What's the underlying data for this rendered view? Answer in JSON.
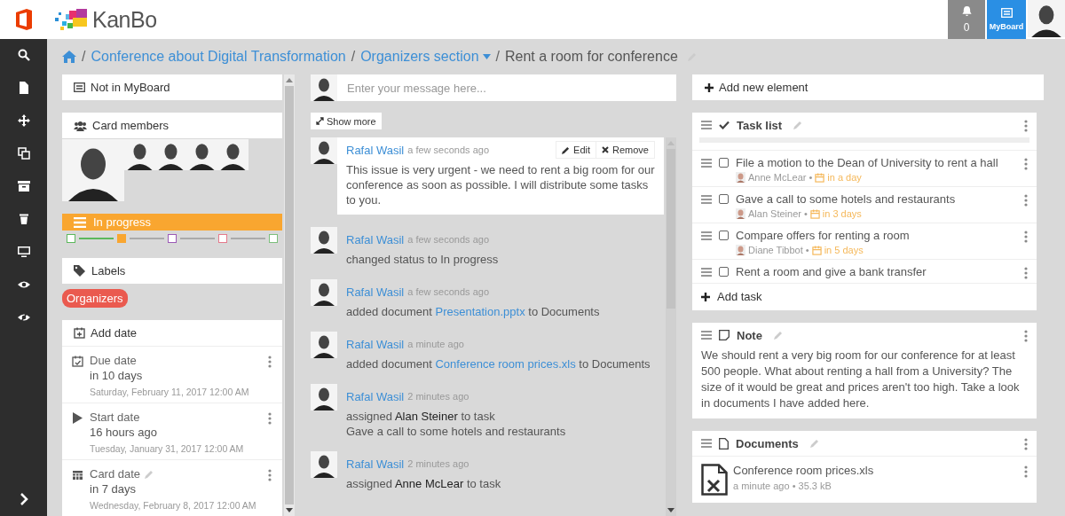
{
  "header": {
    "brand": "KanBo",
    "notifications": "0",
    "myboard": "MyBoard"
  },
  "breadcrumb": [
    {
      "separator": "/",
      "text": "Conference about Digital Transformation",
      "kind": "link"
    },
    {
      "separator": "/",
      "text": "Organizers section",
      "kind": "dropdown"
    },
    {
      "separator": "/",
      "text": "Rent a room for conference",
      "kind": "current"
    }
  ],
  "details": {
    "myboard": "Not in MyBoard",
    "members_title": "Card members",
    "status": {
      "label": "In progress",
      "steps": [
        {
          "color": "#5cb85c",
          "selected": false
        },
        {
          "color": "#f9a630",
          "selected": true
        },
        {
          "color": "#9b59b6",
          "selected": false
        },
        {
          "color": "#e57a8c",
          "selected": false
        },
        {
          "color": "#7cbf7c",
          "selected": false
        }
      ]
    },
    "labels_title": "Labels",
    "labels": [
      {
        "text": "Organizers",
        "color": "#ea5a4f"
      }
    ],
    "dates_title": "Add date",
    "dates": [
      {
        "kind": "due",
        "title": "Due date",
        "relative": "in 10 days",
        "full": "Saturday, February 11, 2017 12:00 AM",
        "editable": false
      },
      {
        "kind": "start",
        "title": "Start date",
        "relative": "16 hours ago",
        "full": "Tuesday, January 31, 2017 12:00 AM",
        "editable": false
      },
      {
        "kind": "card",
        "title": "Card date",
        "relative": "in 7 days",
        "full": "Wednesday, February 8, 2017 12:00 AM",
        "editable": true
      }
    ]
  },
  "chat": {
    "placeholder": "Enter your message here...",
    "show_more": "Show more",
    "messages": [
      {
        "kind": "comment",
        "author": "Rafal Wasil",
        "time": "a few seconds ago",
        "actions": [
          "Edit",
          "Remove"
        ],
        "parts": [
          {
            "kind": "text",
            "text": " This issue is very urgent - we need to rent a big room for our conference as soon as possible. I will distribute some tasks to you."
          }
        ]
      },
      {
        "kind": "activity",
        "author": "Rafal Wasil",
        "time": "a few seconds ago",
        "parts": [
          {
            "kind": "text",
            "text": "changed status to In progress"
          }
        ]
      },
      {
        "kind": "activity",
        "author": "Rafal Wasil",
        "time": "a few seconds ago",
        "parts": [
          {
            "kind": "text",
            "text": "added document "
          },
          {
            "kind": "link",
            "text": "Presentation.pptx"
          },
          {
            "kind": "text",
            "text": " to Documents"
          }
        ]
      },
      {
        "kind": "activity",
        "author": "Rafal Wasil",
        "time": "a minute ago",
        "parts": [
          {
            "kind": "text",
            "text": "added document "
          },
          {
            "kind": "link",
            "text": "Conference room prices.xls"
          },
          {
            "kind": "text",
            "text": " to Documents"
          }
        ]
      },
      {
        "kind": "activity",
        "author": "Rafal Wasil",
        "time": "2 minutes ago",
        "parts": [
          {
            "kind": "text",
            "text": "assigned "
          },
          {
            "kind": "person",
            "text": "Alan Steiner"
          },
          {
            "kind": "text",
            "text": " to task"
          }
        ],
        "detail": "Gave a call to some hotels and restaurants"
      },
      {
        "kind": "activity",
        "author": "Rafal Wasil",
        "time": "2 minutes ago",
        "parts": [
          {
            "kind": "text",
            "text": "assigned "
          },
          {
            "kind": "person",
            "text": "Anne McLear"
          },
          {
            "kind": "text",
            "text": " to task"
          }
        ]
      }
    ]
  },
  "elements": {
    "add_element": "Add new element",
    "task_list": {
      "title": "Task list",
      "level": 0,
      "add_task": "Add task",
      "tasks": [
        {
          "text": "File a motion to the Dean of University to rent a hall",
          "checked": false,
          "assignee": "Anne McLear",
          "separator": "•",
          "due": "in a day"
        },
        {
          "text": "Gave a call to some hotels and restaurants",
          "checked": false,
          "assignee": "Alan Steiner",
          "separator": "•",
          "due": "in 3 days"
        },
        {
          "text": "Compare offers for renting a room",
          "checked": false,
          "assignee": "Diane Tibbot",
          "separator": "•",
          "due": "in 5 days"
        },
        {
          "text": "Rent a room and give a bank transfer",
          "checked": false
        }
      ]
    },
    "note": {
      "title": "Note",
      "text": " We should rent a very big room for our conference for at least 500 people. What about renting a hall from a University? The size of it would be great and prices aren't too high. Take a look in documents I have added here."
    },
    "documents": {
      "title": "Documents",
      "files": [
        {
          "name": "Conference room prices.xls",
          "meta": "a minute ago • 35.3 kB"
        }
      ]
    }
  }
}
